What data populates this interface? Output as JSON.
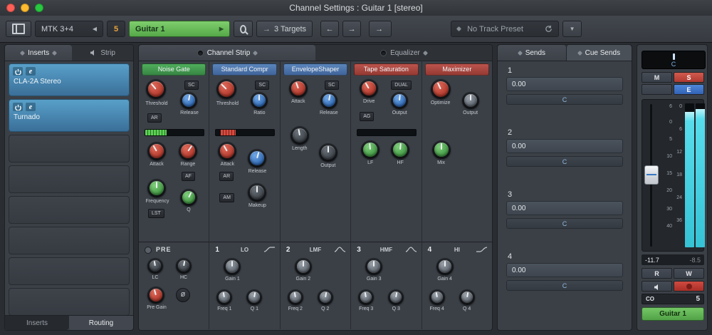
{
  "titlebar": {
    "title": "Channel Settings : Guitar 1 [stereo]"
  },
  "toolbar": {
    "input_name": "MTK 3+4",
    "channel_number": "5",
    "channel_name": "Guitar 1",
    "targets_label": "3 Targets",
    "preset_label": "No Track Preset"
  },
  "inserts": {
    "tab_label": "Inserts",
    "strip_tab_label": "Strip",
    "edit_icon_label": "e",
    "slots": [
      {
        "name": "CLA-2A Stereo"
      },
      {
        "name": "Turnado"
      }
    ],
    "bottom_tabs": {
      "inserts": "Inserts",
      "routing": "Routing"
    }
  },
  "strip": {
    "tabs": {
      "channel_strip": "Channel Strip",
      "equalizer": "Equalizer"
    },
    "noise_gate": {
      "title": "Noise Gate",
      "threshold": "Threshold",
      "release": "Release",
      "attack": "Attack",
      "range": "Range",
      "frequency": "Frequency",
      "q": "Q",
      "sc": "SC",
      "ar": "AR",
      "af": "AF",
      "lst": "LST"
    },
    "compressor": {
      "title": "Standard Compr",
      "threshold": "Threshold",
      "ratio": "Ratio",
      "attack": "Attack",
      "release": "Release",
      "makeup": "Makeup",
      "sc": "SC",
      "ar": "AR",
      "am": "AM"
    },
    "envelope_shaper": {
      "title": "EnvelopeShaper",
      "attack": "Attack",
      "release": "Release",
      "length": "Length",
      "output": "Output",
      "sc": "SC"
    },
    "tape_saturation": {
      "title": "Tape Saturation",
      "drive": "Drive",
      "output": "Output",
      "lf": "LF",
      "hf": "HF",
      "dual": "DUAL",
      "ag": "AG"
    },
    "maximizer": {
      "title": "Maximizer",
      "optimize": "Optimize",
      "output": "Output",
      "mix": "Mix"
    },
    "eq": {
      "pre_label": "PRE",
      "lc": "LC",
      "hc": "HC",
      "pre_gain": "Pre Gain",
      "phase": "ø",
      "bands": [
        {
          "number": "1",
          "name": "LO",
          "gain": "Gain 1",
          "freq": "Freq 1",
          "q": "Q 1"
        },
        {
          "number": "2",
          "name": "LMF",
          "gain": "Gain 2",
          "freq": "Freq 2",
          "q": "Q 2"
        },
        {
          "number": "3",
          "name": "HMF",
          "gain": "Gain 3",
          "freq": "Freq 3",
          "q": "Q 3"
        },
        {
          "number": "4",
          "name": "HI",
          "gain": "Gain 4",
          "freq": "Freq 4",
          "q": "Q 4"
        }
      ]
    }
  },
  "sends": {
    "tab_label": "Sends",
    "cue_tab_label": "Cue Sends",
    "slots": [
      {
        "number": "1",
        "level": "0.00",
        "pan": "C"
      },
      {
        "number": "2",
        "level": "0.00",
        "pan": "C"
      },
      {
        "number": "3",
        "level": "0.00",
        "pan": "C"
      },
      {
        "number": "4",
        "level": "0.00",
        "pan": "C"
      }
    ]
  },
  "fader": {
    "pan_value": "C",
    "mute": "M",
    "solo": "S",
    "edit": "E",
    "fader_scale": [
      "6",
      "0",
      "5",
      "10",
      "15",
      "20",
      "30",
      "40"
    ],
    "meter_scale": [
      "0",
      "6",
      "12",
      "18",
      "24",
      "36"
    ],
    "level_left": "-11.7",
    "level_right": "-8.5",
    "read": "R",
    "write": "W",
    "output_badge": "CO",
    "channel_number": "5",
    "channel_name": "Guitar 1"
  },
  "colors": {
    "channel_green": "#63b857",
    "solo_red": "#c4473d",
    "knob_red": "#c0392b",
    "knob_blue": "#3a78c2",
    "knob_green": "#4aa84e",
    "meter_cyan": "#4fd8e8"
  }
}
